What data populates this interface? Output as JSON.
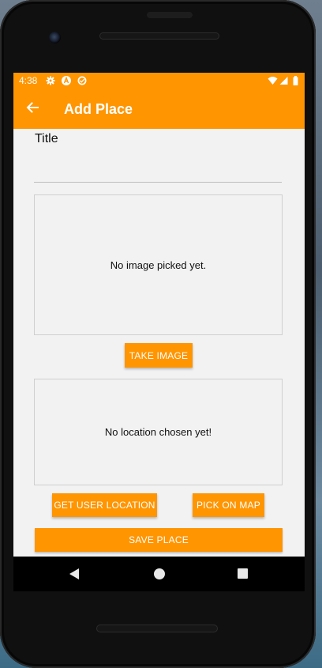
{
  "status_bar": {
    "time": "4:38",
    "left_icons": [
      "settings-gear-icon",
      "react-native-icon",
      "data-saver-icon"
    ],
    "right_icons": [
      "wifi-icon",
      "signal-icon",
      "battery-icon"
    ]
  },
  "app_bar": {
    "title": "Add Place",
    "back_icon": "arrow-left-icon",
    "color": "#ff9500"
  },
  "form": {
    "title_label": "Title",
    "title_value": "",
    "image_preview_text": "No image picked yet.",
    "take_image_label": "TAKE IMAGE",
    "location_preview_text": "No location chosen yet!",
    "get_location_label": "GET USER LOCATION",
    "pick_on_map_label": "PICK ON MAP",
    "save_label": "SAVE PLACE"
  },
  "nav_bar": {
    "buttons": [
      "back-triangle-icon",
      "home-circle-icon",
      "recents-square-icon"
    ]
  },
  "colors": {
    "accent": "#ff9500",
    "screen_background": "#f2f2f2",
    "button_text": "#ffffff"
  }
}
